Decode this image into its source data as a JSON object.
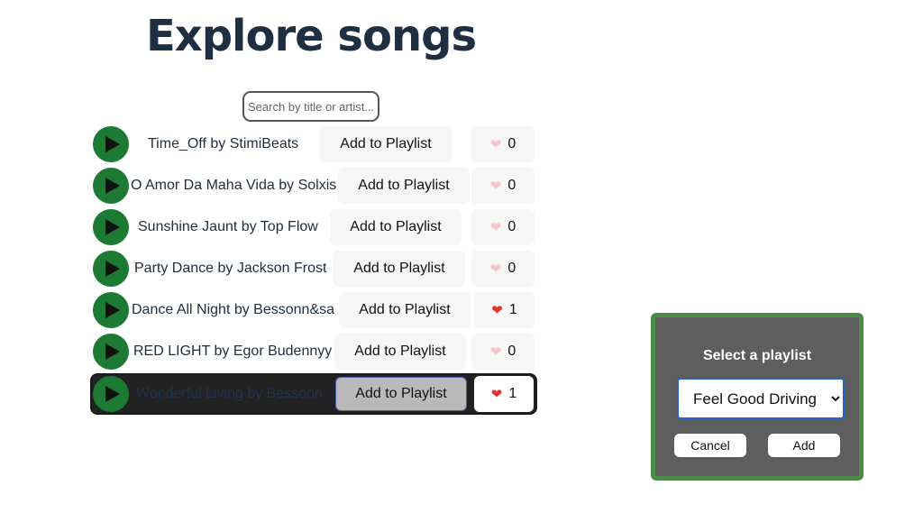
{
  "page": {
    "title": "Explore songs"
  },
  "search": {
    "placeholder": "Search by title or artist..."
  },
  "add_label": "Add to Playlist",
  "songs": [
    {
      "label": "Time_Off by StimiBeats",
      "liked": false,
      "likes": "0"
    },
    {
      "label": "O Amor Da Maha Vida by Solxis",
      "liked": false,
      "likes": "0"
    },
    {
      "label": "Sunshine Jaunt by Top Flow",
      "liked": false,
      "likes": "0"
    },
    {
      "label": "Party Dance by Jackson Frost",
      "liked": false,
      "likes": "0"
    },
    {
      "label": "Dance All Night by Bessonn&sa",
      "liked": true,
      "likes": "1"
    },
    {
      "label": "RED LIGHT by Egor Budennyy",
      "liked": false,
      "likes": "0"
    },
    {
      "label": "Wonderful Living by Bessonn",
      "liked": true,
      "likes": "1",
      "selected": true
    }
  ],
  "dialog": {
    "title": "Select a playlist",
    "selected_option": "Feel Good Driving",
    "cancel_label": "Cancel",
    "add_label": "Add"
  },
  "icons": {
    "play": "play-icon",
    "heart": "heart-icon",
    "dropdown": "chevron-down-icon"
  },
  "colors": {
    "play_button": "#1c7a34",
    "heart_liked": "#e23434",
    "heart_unliked": "#f7c4cc",
    "dialog_bg": "#5e5e5e",
    "dialog_border": "#4c8b47"
  }
}
